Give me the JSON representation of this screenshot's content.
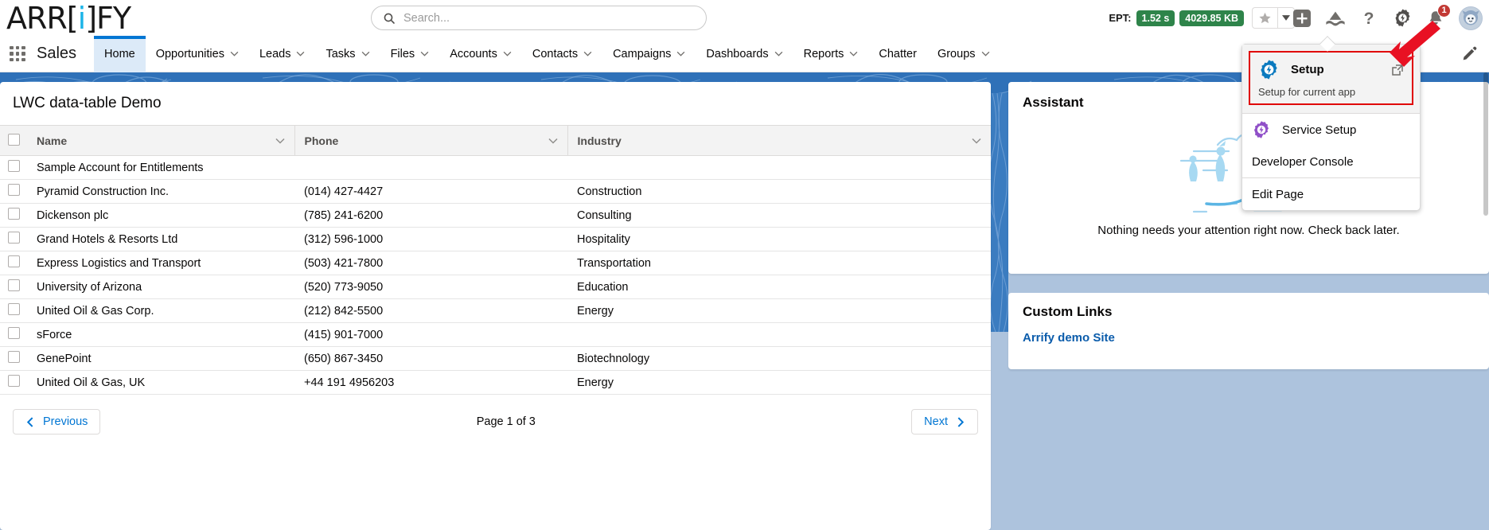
{
  "brand": {
    "pre": "ARR[",
    "i": "i",
    "post": "]FY"
  },
  "search": {
    "placeholder": "Search...",
    "value": "",
    "icon": "search-icon"
  },
  "header": {
    "ept_label": "EPT:",
    "ept_time": "1.52 s",
    "ept_size": "4029.85 KB",
    "icons": [
      "favorite-star-icon",
      "favorite-caret-icon",
      "add-icon",
      "favorites-mountain-icon",
      "help-icon",
      "setup-gear-icon",
      "notifications-bell-icon",
      "user-avatar"
    ],
    "notification_count": "1",
    "accent_blue": "#0176d3",
    "badge_green": "#2e844a",
    "badge_red": "#c23934"
  },
  "app_nav": {
    "app_name": "Sales",
    "waffle_icon": "app-launcher-icon",
    "edit_icon": "edit-pencil-icon",
    "items": [
      {
        "label": "Home",
        "has_caret": false,
        "active": true
      },
      {
        "label": "Opportunities",
        "has_caret": true,
        "active": false
      },
      {
        "label": "Leads",
        "has_caret": true,
        "active": false
      },
      {
        "label": "Tasks",
        "has_caret": true,
        "active": false
      },
      {
        "label": "Files",
        "has_caret": true,
        "active": false
      },
      {
        "label": "Accounts",
        "has_caret": true,
        "active": false
      },
      {
        "label": "Contacts",
        "has_caret": true,
        "active": false
      },
      {
        "label": "Campaigns",
        "has_caret": true,
        "active": false
      },
      {
        "label": "Dashboards",
        "has_caret": true,
        "active": false
      },
      {
        "label": "Reports",
        "has_caret": true,
        "active": false
      },
      {
        "label": "Chatter",
        "has_caret": false,
        "active": false
      },
      {
        "label": "Groups",
        "has_caret": true,
        "active": false
      }
    ]
  },
  "setup_menu": {
    "hero": {
      "title": "Setup",
      "subtitle": "Setup for current app",
      "icon": "setup-gear-icon",
      "external_icon": "external-link-icon",
      "highlight_color": "#e00000"
    },
    "items": [
      {
        "label": "Service Setup",
        "icon": "service-setup-gear-icon"
      },
      {
        "label": "Developer Console",
        "icon": null
      },
      {
        "label": "Edit Page",
        "icon": null
      }
    ]
  },
  "table_card": {
    "title": "LWC data-table Demo",
    "columns": [
      "Name",
      "Phone",
      "Industry"
    ],
    "rows": [
      {
        "name": "Sample Account for Entitlements",
        "phone": "",
        "industry": ""
      },
      {
        "name": "Pyramid Construction Inc.",
        "phone": "(014) 427-4427",
        "industry": "Construction"
      },
      {
        "name": "Dickenson plc",
        "phone": "(785) 241-6200",
        "industry": "Consulting"
      },
      {
        "name": "Grand Hotels & Resorts Ltd",
        "phone": "(312) 596-1000",
        "industry": "Hospitality"
      },
      {
        "name": "Express Logistics and Transport",
        "phone": "(503) 421-7800",
        "industry": "Transportation"
      },
      {
        "name": "University of Arizona",
        "phone": "(520) 773-9050",
        "industry": "Education"
      },
      {
        "name": "United Oil & Gas Corp.",
        "phone": "(212) 842-5500",
        "industry": "Energy"
      },
      {
        "name": "sForce",
        "phone": "(415) 901-7000",
        "industry": ""
      },
      {
        "name": "GenePoint",
        "phone": "(650) 867-3450",
        "industry": "Biotechnology"
      },
      {
        "name": "United Oil & Gas, UK",
        "phone": "+44 191 4956203",
        "industry": "Energy"
      }
    ],
    "pagination": {
      "previous_label": "Previous",
      "next_label": "Next",
      "page_info": "Page 1 of 3"
    }
  },
  "assistant": {
    "title": "Assistant",
    "empty_message": "Nothing needs your attention right now. Check back later."
  },
  "custom_links": {
    "title": "Custom Links",
    "links": [
      {
        "label": "Arrify demo Site"
      }
    ]
  }
}
